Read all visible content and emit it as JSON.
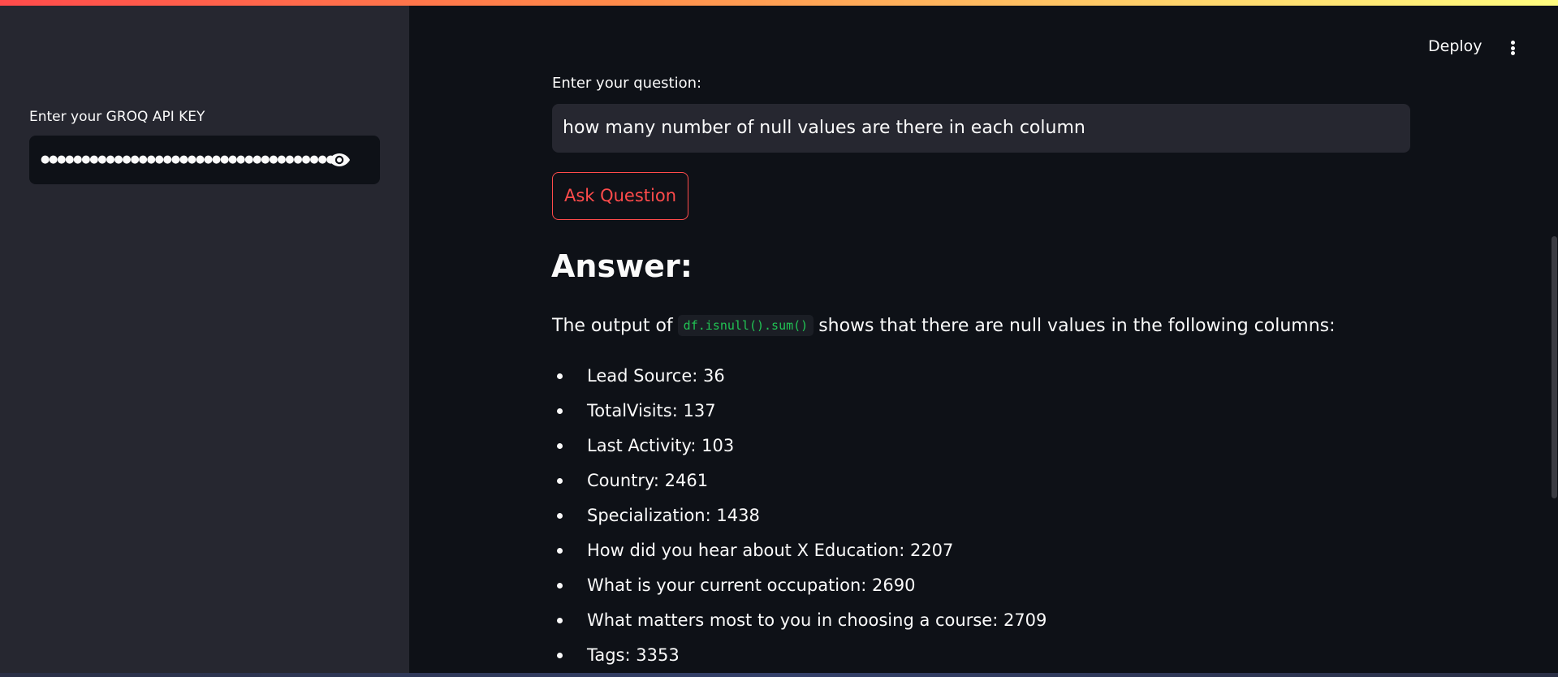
{
  "sidebar": {
    "api_key_label": "Enter your GROQ API KEY",
    "api_key_value": "●●●●●●●●●●●●●●●●●●●●●●●●●●●●●●●●●●●●●●●●●●●●●●●●●●●●●●"
  },
  "header": {
    "deploy_label": "Deploy"
  },
  "main": {
    "question_label": "Enter your question:",
    "question_value": "how many number of null values are there in each column",
    "ask_button_label": "Ask Question",
    "answer_heading": "Answer:",
    "output_prefix": "The output of",
    "output_code": "df.isnull().sum()",
    "output_suffix": "shows that there are null values in the following columns:",
    "items": [
      "Lead Source: 36",
      "TotalVisits: 137",
      "Last Activity: 103",
      "Country: 2461",
      "Specialization: 1438",
      "How did you hear about X Education: 2207",
      "What is your current occupation: 2690",
      "What matters most to you in choosing a course: 2709",
      "Tags: 3353"
    ]
  },
  "colors": {
    "accent": "#ff4b4b",
    "sidebar_bg": "#262730",
    "main_bg": "#0e1117",
    "code_text": "#21c354"
  },
  "icons": {
    "password_toggle": "eye-icon",
    "menu": "kebab-menu-icon"
  }
}
